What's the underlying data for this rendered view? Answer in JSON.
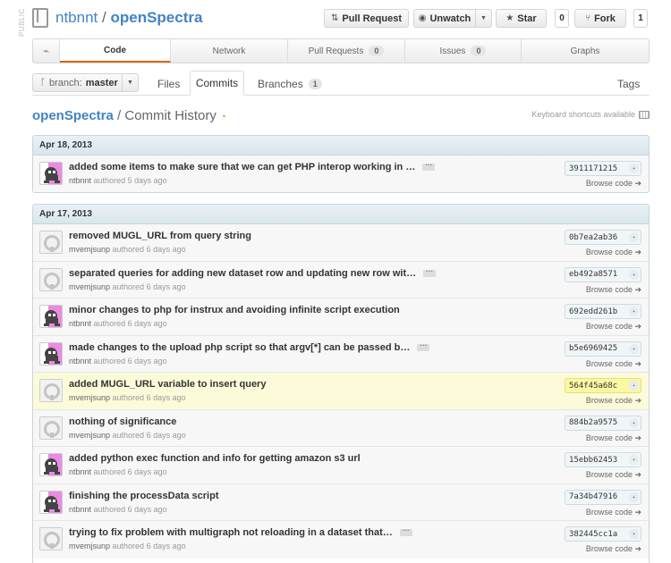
{
  "header": {
    "public_label": "PUBLIC",
    "owner": "ntbnnt",
    "separator": "/",
    "repo": "openSpectra",
    "actions": {
      "pull_request": "Pull Request",
      "unwatch": "Unwatch",
      "star": "Star",
      "star_count": "0",
      "fork": "Fork",
      "fork_count": "1"
    }
  },
  "tabs": [
    {
      "label": "Code",
      "count": ""
    },
    {
      "label": "Network",
      "count": ""
    },
    {
      "label": "Pull Requests",
      "count": "0"
    },
    {
      "label": "Issues",
      "count": "0"
    },
    {
      "label": "Graphs",
      "count": ""
    }
  ],
  "subnav": {
    "branch_prefix": "branch:",
    "branch": "master",
    "files": "Files",
    "commits": "Commits",
    "branches": "Branches",
    "branches_count": "1",
    "tags": "Tags"
  },
  "history": {
    "repo": "openSpectra",
    "title": "Commit History",
    "keyboard_hint": "Keyboard shortcuts available"
  },
  "labels": {
    "authored": "authored",
    "browse_code": "Browse code ➔"
  },
  "groups": [
    {
      "date": "Apr 18, 2013",
      "commits": [
        {
          "message": "added some items to make sure that we can get PHP interop working in …",
          "author": "ntbnnt",
          "avatar": "identicon-pink",
          "when": "5 days ago",
          "sha": "3911171215",
          "truncated": true
        }
      ]
    },
    {
      "date": "Apr 17, 2013",
      "commits": [
        {
          "message": "removed MUGL_URL from query string",
          "author": "mvemjsunp",
          "avatar": "octocat-gray",
          "when": "6 days ago",
          "sha": "0b7ea2ab36",
          "truncated": false
        },
        {
          "message": "separated queries for adding new dataset row and updating new row wit…",
          "author": "mvemjsunp",
          "avatar": "octocat-gray",
          "when": "6 days ago",
          "sha": "eb492a8571",
          "truncated": true
        },
        {
          "message": "minor changes to php for instrux and avoiding infinite script execution",
          "author": "ntbnnt",
          "avatar": "identicon-pink",
          "when": "6 days ago",
          "sha": "692edd261b",
          "truncated": false
        },
        {
          "message": "made changes to the upload php script so that argv[*] can be passed b…",
          "author": "ntbnnt",
          "avatar": "identicon-pink",
          "when": "6 days ago",
          "sha": "b5e6969425",
          "truncated": true
        },
        {
          "message": "added MUGL_URL variable to insert query",
          "author": "mvemjsunp",
          "avatar": "octocat-gray",
          "when": "6 days ago",
          "sha": "564f45a68c",
          "truncated": false,
          "highlighted": true
        },
        {
          "message": "nothing of significance",
          "author": "mvemjsunp",
          "avatar": "octocat-gray",
          "when": "6 days ago",
          "sha": "884b2a9575",
          "truncated": false
        },
        {
          "message": "added python exec function and info for getting amazon s3 url",
          "author": "ntbnnt",
          "avatar": "identicon-pink",
          "when": "6 days ago",
          "sha": "15ebb62453",
          "truncated": false
        },
        {
          "message": "finishing the processData script",
          "author": "ntbnnt",
          "avatar": "identicon-pink",
          "when": "6 days ago",
          "sha": "7a34b47916",
          "truncated": false
        },
        {
          "message": "trying to fix problem with multigraph not reloading in a dataset that…",
          "author": "mvemjsunp",
          "avatar": "octocat-gray",
          "when": "6 days ago",
          "sha": "382445cc1a",
          "truncated": true
        }
      ]
    }
  ],
  "colors": {
    "accent": "#4183c4",
    "active_tab": "#d26911",
    "highlight": "#fcfbd9"
  }
}
